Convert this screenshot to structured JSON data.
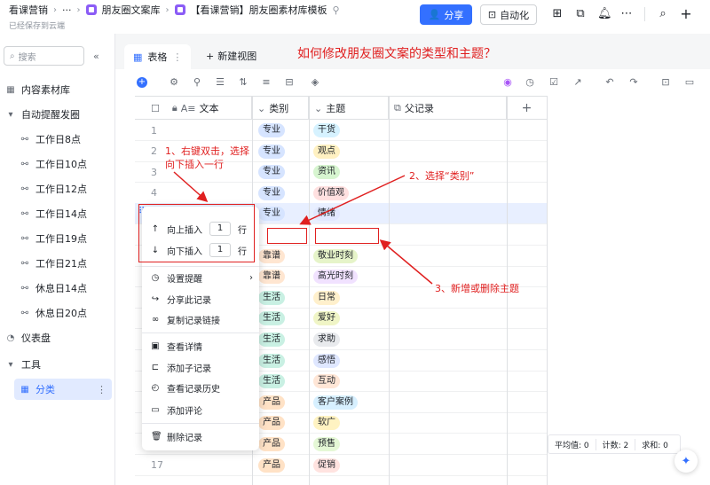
{
  "header": {
    "breadcrumb": [
      "看课营销",
      "···",
      "朋友圈文案库",
      "【看课营销】朋友圈素材库模板"
    ],
    "saved_text": "已经保存到云端",
    "share_label": "分享",
    "automation_label": "自动化"
  },
  "sidebar": {
    "search_placeholder": "搜索",
    "items": [
      {
        "label": "内容素材库"
      },
      {
        "label": "自动提醒发圈"
      },
      {
        "label": "工作日8点"
      },
      {
        "label": "工作日10点"
      },
      {
        "label": "工作日12点"
      },
      {
        "label": "工作日14点"
      },
      {
        "label": "工作日19点"
      },
      {
        "label": "工作日21点"
      },
      {
        "label": "休息日14点"
      },
      {
        "label": "休息日20点"
      },
      {
        "label": "仪表盘"
      },
      {
        "label": "工具"
      },
      {
        "label": "分类"
      }
    ]
  },
  "tabs": {
    "active": "表格",
    "new_view": "新建视图",
    "headline": "如何修改朋友圈文案的类型和主题？"
  },
  "grid": {
    "columns": [
      "文本",
      "类别",
      "主题",
      "父记录"
    ],
    "rows": [
      {
        "num": "1",
        "category": "专业",
        "topic": "干货"
      },
      {
        "num": "2",
        "category": "专业",
        "topic": "观点"
      },
      {
        "num": "3",
        "category": "专业",
        "topic": "资讯"
      },
      {
        "num": "4",
        "category": "专业",
        "topic": "价值观"
      },
      {
        "num": "",
        "category": "专业",
        "topic": "情绪"
      },
      {
        "num": "",
        "category": "",
        "topic": ""
      },
      {
        "num": "",
        "category": "靠谱",
        "topic": "敬业时刻"
      },
      {
        "num": "",
        "category": "靠谱",
        "topic": "高光时刻"
      },
      {
        "num": "",
        "category": "生活",
        "topic": "日常"
      },
      {
        "num": "",
        "category": "生活",
        "topic": "爱好"
      },
      {
        "num": "",
        "category": "生活",
        "topic": "求助"
      },
      {
        "num": "",
        "category": "生活",
        "topic": "感悟"
      },
      {
        "num": "",
        "category": "生活",
        "topic": "互动"
      },
      {
        "num": "",
        "category": "产品",
        "topic": "客户案例"
      },
      {
        "num": "",
        "category": "产品",
        "topic": "软广"
      },
      {
        "num": "",
        "category": "产品",
        "topic": "预售"
      },
      {
        "num": "17",
        "category": "产品",
        "topic": "促销"
      }
    ]
  },
  "context_menu": {
    "insert_above": "向上插入",
    "insert_below": "向下插入",
    "insert_count": "1",
    "row_unit": "行",
    "items": [
      "设置提醒",
      "分享此记录",
      "复制记录链接",
      "查看详情",
      "添加子记录",
      "查看记录历史",
      "添加评论",
      "删除记录"
    ]
  },
  "annotations": {
    "step1_line1": "1、右键双击，选择",
    "step1_line2": "向下插入一行",
    "step2": "2、选择“类别”",
    "step3": "3、新增或删除主题"
  },
  "stats": {
    "avg": "平均值: 0",
    "count": "计数: 2",
    "sum": "求和: 0"
  }
}
